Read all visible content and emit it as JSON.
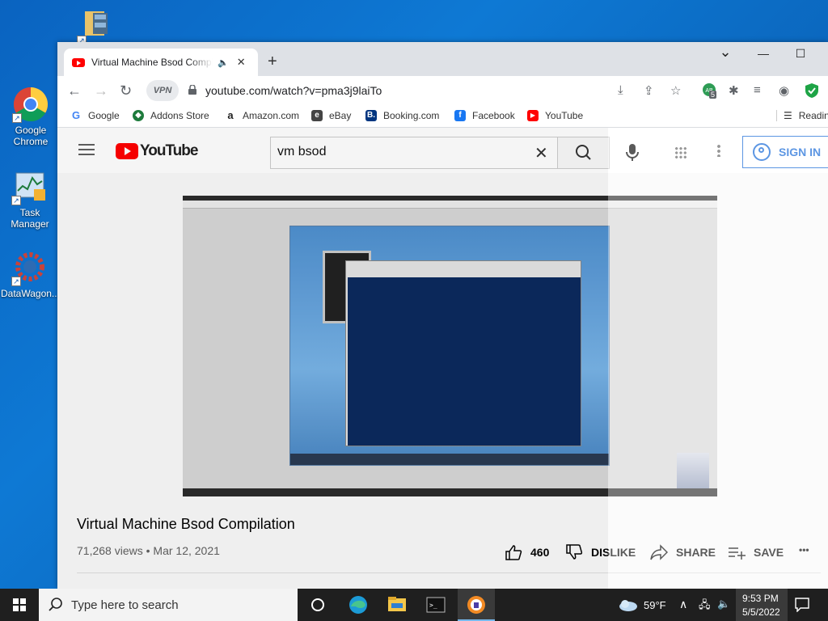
{
  "desktop": {
    "icons": [
      {
        "label": ""
      },
      {
        "label": "Google Chrome"
      },
      {
        "label": "Task Manager"
      },
      {
        "label": "DataWagon..."
      }
    ]
  },
  "browser": {
    "tab": {
      "title": "Virtual Machine Bsod Compilation",
      "audio_icon": "speaker-icon",
      "close": "✕"
    },
    "new_tab": "+",
    "window_controls": {
      "minimize": "—",
      "maximize": "☐",
      "close": "✕",
      "tab_search": "⌄"
    },
    "vpn_label": "VPN",
    "url": "youtube.com/watch?v=pma3j9laiTo",
    "extension_badge": "5",
    "bookmarks": [
      {
        "label": "Google",
        "color": "#4285f4",
        "glyph": "G"
      },
      {
        "label": "Addons Store",
        "color": "#1e7b3c",
        "glyph": "◆"
      },
      {
        "label": "Amazon.com",
        "color": "#222222",
        "glyph": "a"
      },
      {
        "label": "eBay",
        "color": "#e53238",
        "glyph": "e"
      },
      {
        "label": "Booking.com",
        "color": "#003580",
        "glyph": "B."
      },
      {
        "label": "Facebook",
        "color": "#1877f2",
        "glyph": "f"
      },
      {
        "label": "YouTube",
        "color": "#ff0000",
        "glyph": "▶"
      }
    ],
    "reading_list": "Reading"
  },
  "youtube": {
    "logo_text": "YouTube",
    "search_value": "vm bsod",
    "sign_in": "SIGN IN",
    "video_title": "Virtual Machine Bsod Compilation",
    "views": "71,268 views",
    "separator": "•",
    "date": "Mar 12, 2021",
    "likes": "460",
    "dislike": "DISLIKE",
    "share": "SHARE",
    "save": "SAVE",
    "more": "•••"
  },
  "taskbar": {
    "search_placeholder": "Type here to search",
    "weather": "59°F",
    "time": "9:53 PM",
    "date": "5/5/2022"
  }
}
